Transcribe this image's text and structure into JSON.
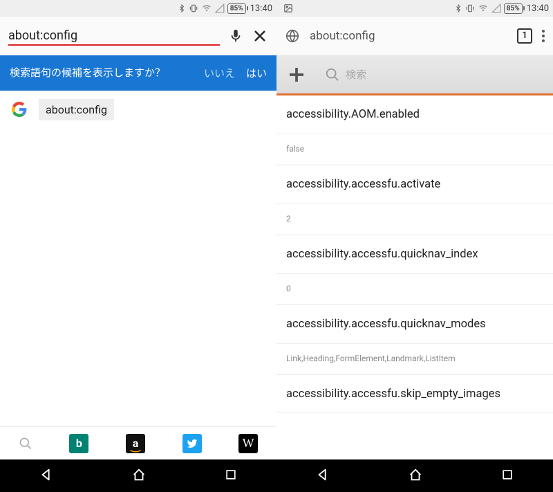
{
  "status": {
    "battery": "85%",
    "time": "13:40"
  },
  "left": {
    "url": "about:config",
    "prompt": {
      "text": "検索語句の候補を表示しますか？",
      "no": "いいえ",
      "yes": "はい"
    },
    "suggestion": "about:config",
    "bookmarks": {
      "bing": "b",
      "amazon": "a",
      "twitter": "",
      "wiki": "W"
    }
  },
  "right": {
    "url": "about:config",
    "tabs": "1",
    "search_placeholder": "検索",
    "prefs": [
      {
        "name": "accessibility.AOM.enabled",
        "value": "false"
      },
      {
        "name": "accessibility.accessfu.activate",
        "value": "2"
      },
      {
        "name": "accessibility.accessfu.quicknav_index",
        "value": "0"
      },
      {
        "name": "accessibility.accessfu.quicknav_modes",
        "value": "Link,Heading,FormElement,Landmark,ListItem"
      },
      {
        "name": "accessibility.accessfu.skip_empty_images",
        "value": ""
      }
    ]
  }
}
